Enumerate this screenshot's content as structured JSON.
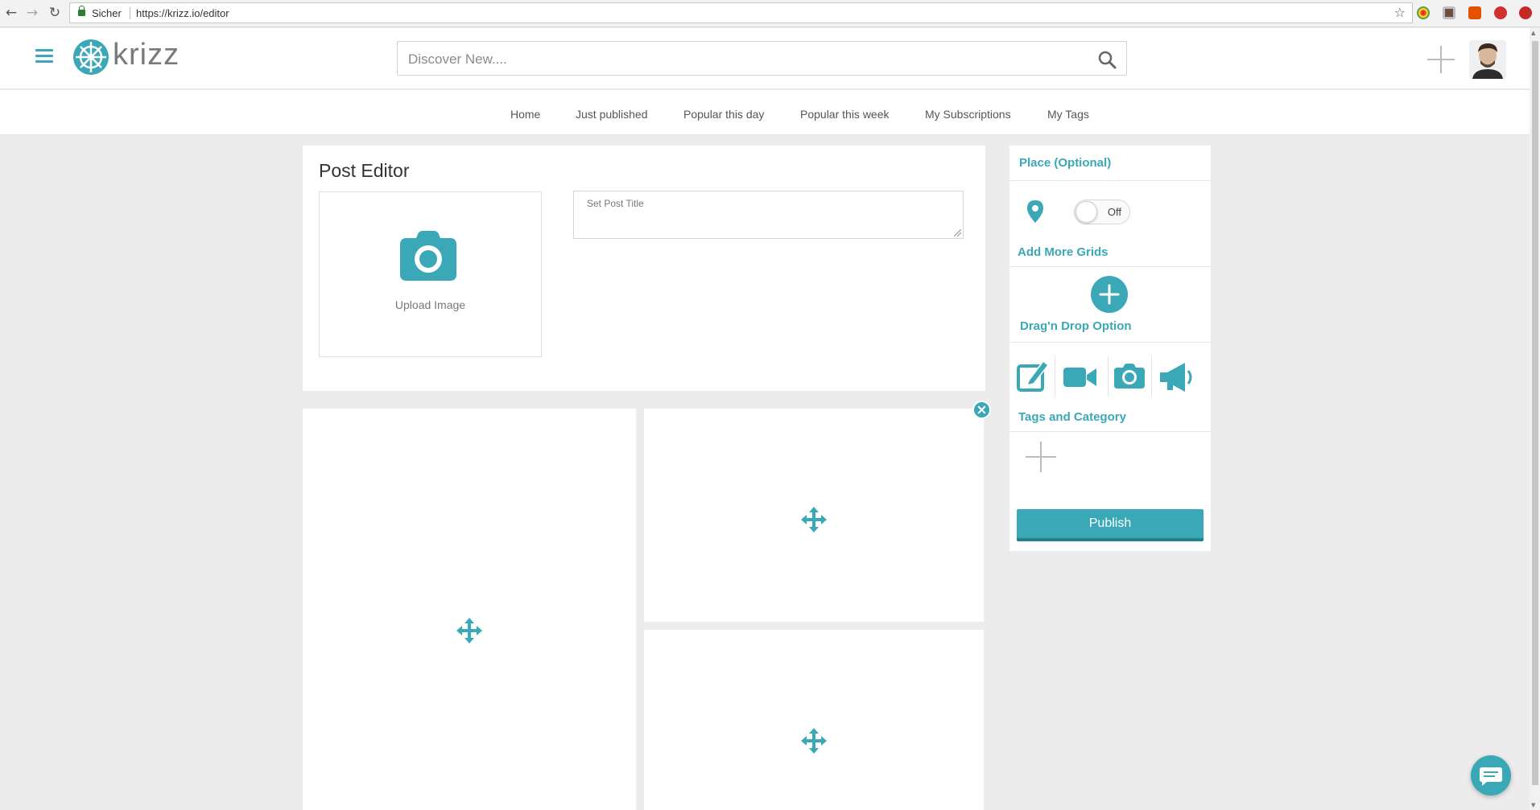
{
  "browser": {
    "back_icon": "←",
    "forward_icon": "→",
    "reload_icon": "↻",
    "secure_label": "Sicher",
    "url": "https://krizz.io/editor",
    "star_icon": "☆"
  },
  "header": {
    "logo_text": "krizz",
    "search_placeholder": "Discover New...."
  },
  "nav": {
    "items": [
      {
        "label": "Home"
      },
      {
        "label": "Just published"
      },
      {
        "label": "Popular this day"
      },
      {
        "label": "Popular this week"
      },
      {
        "label": "My Subscriptions"
      },
      {
        "label": "My Tags"
      }
    ]
  },
  "editor": {
    "title": "Post Editor",
    "upload_label": "Upload Image",
    "title_placeholder": "Set Post Title"
  },
  "sidebar": {
    "place_heading": "Place (Optional)",
    "toggle_label": "Off",
    "add_grids_heading": "Add More Grids",
    "drag_drop_heading": "Drag'n Drop Option",
    "tags_heading": "Tags and Category",
    "publish_label": "Publish"
  },
  "colors": {
    "accent": "#3aa8b7",
    "accent_dark": "#23808d",
    "background": "#ececec"
  }
}
